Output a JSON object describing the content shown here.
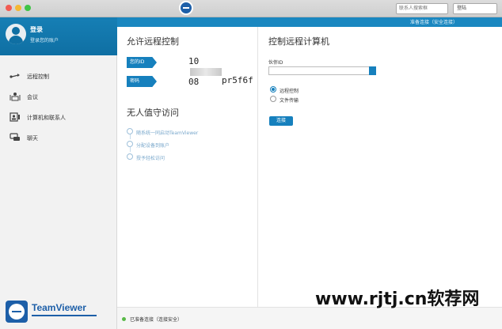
{
  "titlebar": {
    "search_placeholder": "联系人搜索框",
    "login_label": "登陆"
  },
  "sidebar": {
    "profile": {
      "name": "登录",
      "status": "登录您的账户"
    },
    "items": [
      {
        "label": "远程控制",
        "icon": "remote-control-icon"
      },
      {
        "label": "会议",
        "icon": "meeting-icon"
      },
      {
        "label": "计算机和联系人",
        "icon": "contacts-icon"
      },
      {
        "label": "聊天",
        "icon": "chat-icon"
      }
    ],
    "brand": {
      "name": "TeamViewer",
      "color": "#1d5fa8"
    }
  },
  "main": {
    "stripe_text": "准备连接（安全连接）",
    "allow": {
      "title": "允许远程控制",
      "id_label": "您的ID",
      "id_value_start": "10",
      "id_value_end": "08",
      "password_label": "密码",
      "password_value": "pr5f6f"
    },
    "unattended": {
      "title": "无人值守访问",
      "steps": [
        "随系统一同启动TeamViewer",
        "分配设备到账户",
        "授予轻松访问"
      ]
    },
    "control": {
      "title": "控制远程计算机",
      "partner_label": "伙伴ID",
      "partner_value": "",
      "options": [
        {
          "label": "远程控制",
          "selected": true
        },
        {
          "label": "文件传输",
          "selected": false
        }
      ],
      "connect_label": "连接"
    },
    "status": {
      "text": "已准备连接（连接安全）",
      "color": "#58b947"
    }
  },
  "watermark": "www.rjtj.cn软荐网",
  "colors": {
    "accent": "#1680bd",
    "header": "#1a87c0"
  }
}
